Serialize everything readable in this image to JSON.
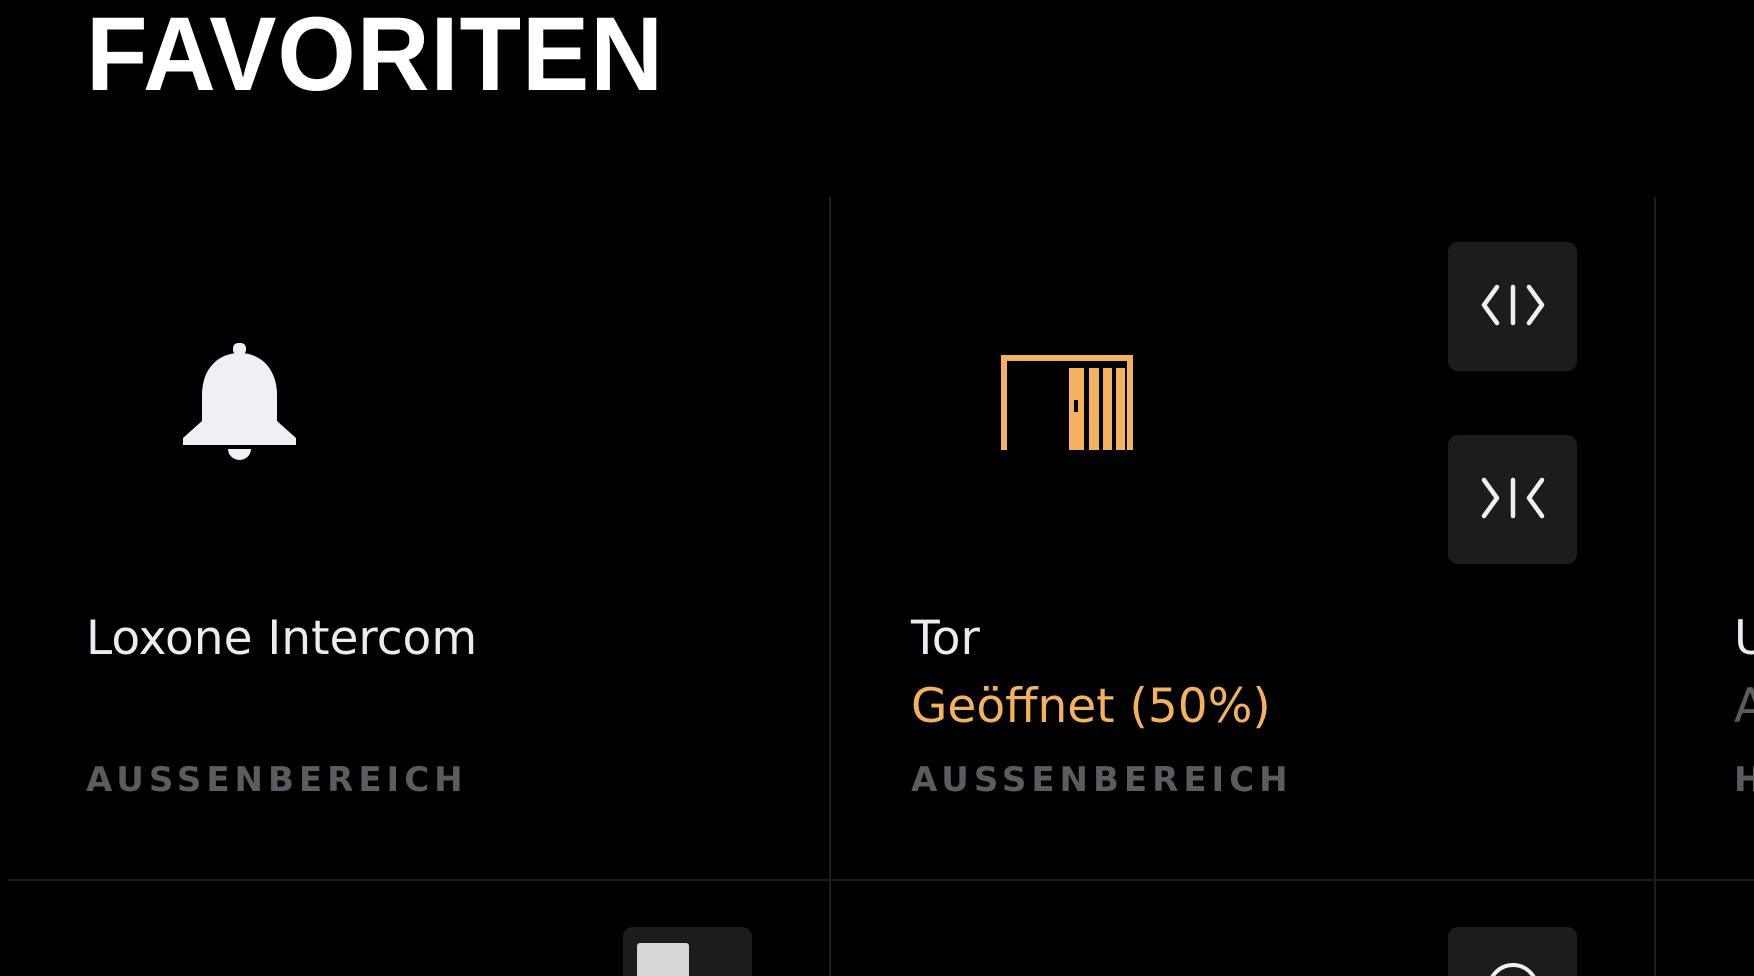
{
  "header": {
    "title": "FAVORITEN"
  },
  "tiles": [
    {
      "name": "Loxone Intercom",
      "room": "AUSSENBEREICH",
      "icon": "bell-icon"
    },
    {
      "name": "Tor",
      "status": "Geöffnet (50%)",
      "room": "AUSSENBEREICH",
      "icon": "gate-icon",
      "buttons": [
        "open-gate-icon",
        "close-gate-icon"
      ]
    },
    {
      "name": "U",
      "status": "A",
      "room": "H"
    }
  ],
  "colors": {
    "accent": "#f4b25f",
    "background": "#000000",
    "button": "#1c1c1e",
    "divider": "#1e1e21",
    "room_text": "#5c5c60",
    "icon_light": "#f0eff6"
  }
}
